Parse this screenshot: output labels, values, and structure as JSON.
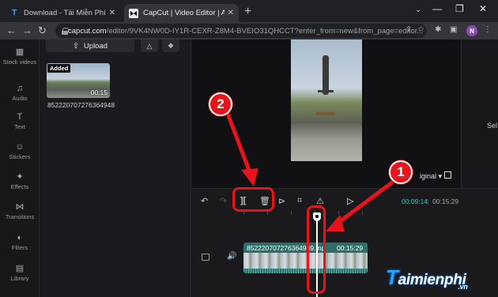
{
  "browser": {
    "tabs": [
      {
        "title": "Download - Tải Miễn Phí VN - Pl",
        "favicon": "T",
        "favicon_name": "taimienphi-favicon",
        "close": "✕"
      },
      {
        "title": "CapCut | Video Editor | All-In-On",
        "favicon": "CC",
        "favicon_name": "capcut-favicon",
        "close": "✕"
      }
    ],
    "new_tab": "+",
    "tab_search": "⌄",
    "window_controls": {
      "minimize": "—",
      "maximize": "❐",
      "close": "✕"
    },
    "url_host": "capcut.com",
    "url_path": "/editor/9VK4NW0D-IY1R-CEXR-Z8M4-BVEIO31QHCCT?enter_from=new&from_page=editor...",
    "profile_initial": "N"
  },
  "sidebar": {
    "items": [
      {
        "label": "Stock videos",
        "icon": "stock-videos-icon"
      },
      {
        "label": "Audio",
        "icon": "audio-icon"
      },
      {
        "label": "Text",
        "icon": "text-icon"
      },
      {
        "label": "Stickers",
        "icon": "stickers-icon"
      },
      {
        "label": "Effects",
        "icon": "effects-icon"
      },
      {
        "label": "Transitions",
        "icon": "transitions-icon"
      },
      {
        "label": "Filters",
        "icon": "filters-icon"
      },
      {
        "label": "Library",
        "icon": "library-icon"
      }
    ]
  },
  "media": {
    "upload_label": "Upload",
    "clip": {
      "tag": "Added",
      "duration": "00:15",
      "name": "852220707276364948"
    }
  },
  "preview": {
    "ratio_label": "iginal",
    "right_panel_text": "Sel"
  },
  "timeline": {
    "current_time": "00:09:14",
    "separator": "|",
    "total_time": "00:15:29",
    "ruler_labels": [
      "00:00",
      "00:03",
      "00:06",
      "00:09",
      "00:12",
      "00:15"
    ],
    "clip_name": "852220707276364949.mp",
    "clip_duration": "00:15:29"
  },
  "callouts": [
    {
      "number": "2",
      "target": "split and delete tools"
    },
    {
      "number": "1",
      "target": "playhead"
    }
  ],
  "colors": {
    "callout_red": "#e8141b",
    "accent_teal": "#22d3c5",
    "clip_teal": "#2d6d6a"
  },
  "watermark": {
    "first_letter": "T",
    "rest": "aimienphi",
    "suffix": ".vn"
  }
}
